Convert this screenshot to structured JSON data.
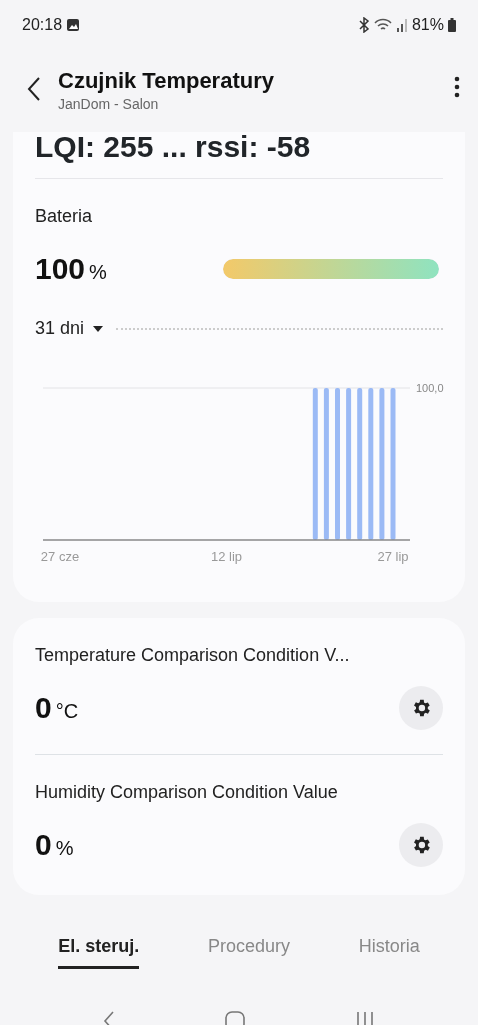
{
  "status_bar": {
    "time": "20:18",
    "battery": "81%"
  },
  "header": {
    "title": "Czujnik Temperatury",
    "subtitle": "JanDom - Salon"
  },
  "link_quality": "LQI: 255 ... rssi: -58",
  "battery": {
    "label": "Bateria",
    "value": "100",
    "unit": "%",
    "level": 1.0
  },
  "period": {
    "label": "31 dni"
  },
  "chart_data": {
    "type": "bar",
    "categories": [
      "27 cze",
      null,
      null,
      null,
      null,
      null,
      null,
      null,
      null,
      null,
      null,
      null,
      null,
      null,
      null,
      "12 lip",
      null,
      null,
      null,
      null,
      null,
      null,
      null,
      null,
      null,
      null,
      null,
      null,
      null,
      null,
      "27 lip"
    ],
    "series": [
      {
        "color": "#9bbaf5",
        "values": [
          null,
          null,
          null,
          null,
          null,
          null,
          null,
          null,
          null,
          null,
          null,
          null,
          null,
          null,
          null,
          null,
          null,
          null,
          null,
          null,
          null,
          null,
          null,
          100,
          100,
          100,
          100,
          100,
          100,
          100,
          100
        ]
      }
    ],
    "ylim": [
      0,
      100
    ],
    "yticks": [
      {
        "value": 100,
        "label": "100,0"
      }
    ]
  },
  "settings": [
    {
      "label": "Temperature Comparison Condition V...",
      "value": "0",
      "unit": "°C"
    },
    {
      "label": "Humidity Comparison Condition Value",
      "value": "0",
      "unit": "%"
    }
  ],
  "tabs": [
    {
      "label": "El. steruj.",
      "selected": true
    },
    {
      "label": "Procedury",
      "selected": false
    },
    {
      "label": "Historia",
      "selected": false
    }
  ]
}
